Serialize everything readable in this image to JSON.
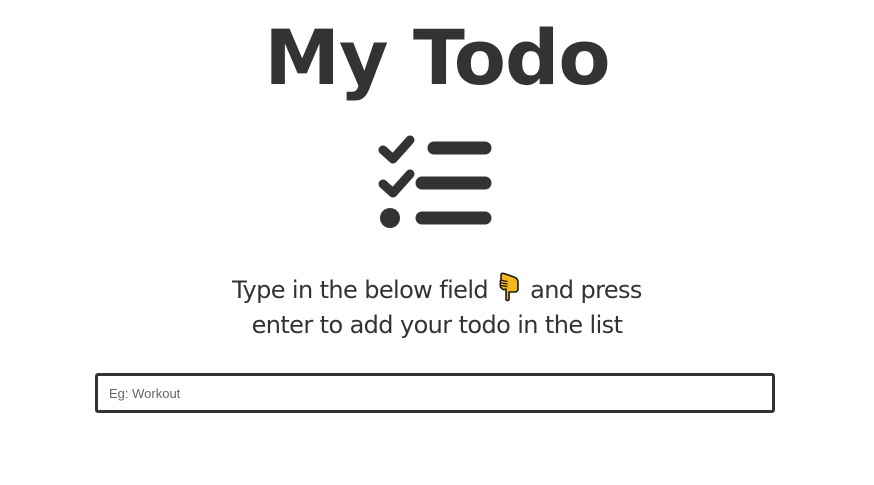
{
  "header": {
    "title": "My Todo",
    "logo_icon": "checklist-icon"
  },
  "instructions": {
    "line1_before": "Type in the below field",
    "pointer_icon": "hand-pointing-down-icon",
    "line1_after": "and press",
    "line2": "enter to add your todo in the list"
  },
  "todo_input": {
    "value": "",
    "placeholder": "Eg: Workout"
  },
  "colors": {
    "text": "#333333",
    "hand_fill": "#f5b81c",
    "hand_outline": "#1a1a1a"
  }
}
